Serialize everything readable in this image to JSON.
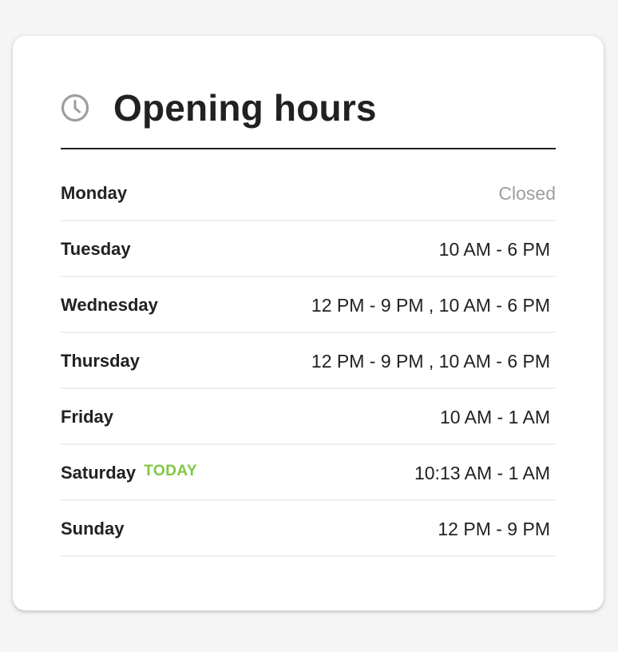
{
  "card": {
    "title": "Opening hours",
    "icon": "clock-icon"
  },
  "colors": {
    "today_badge": "#7ec843",
    "closed_text": "#9e9e9e",
    "text": "#212121"
  },
  "days": [
    {
      "day": "Monday",
      "hours": "Closed",
      "closed": true,
      "today_label": ""
    },
    {
      "day": "Tuesday",
      "hours": "10 AM - 6 PM",
      "closed": false,
      "today_label": ""
    },
    {
      "day": "Wednesday",
      "hours": "12 PM - 9 PM , 10 AM - 6 PM",
      "closed": false,
      "today_label": ""
    },
    {
      "day": "Thursday",
      "hours": "12 PM - 9 PM , 10 AM - 6 PM",
      "closed": false,
      "today_label": ""
    },
    {
      "day": "Friday",
      "hours": "10 AM - 1 AM",
      "closed": false,
      "today_label": ""
    },
    {
      "day": "Saturday",
      "hours": "10:13 AM - 1 AM",
      "closed": false,
      "today_label": "TODAY"
    },
    {
      "day": "Sunday",
      "hours": "12 PM - 9 PM",
      "closed": false,
      "today_label": ""
    }
  ]
}
